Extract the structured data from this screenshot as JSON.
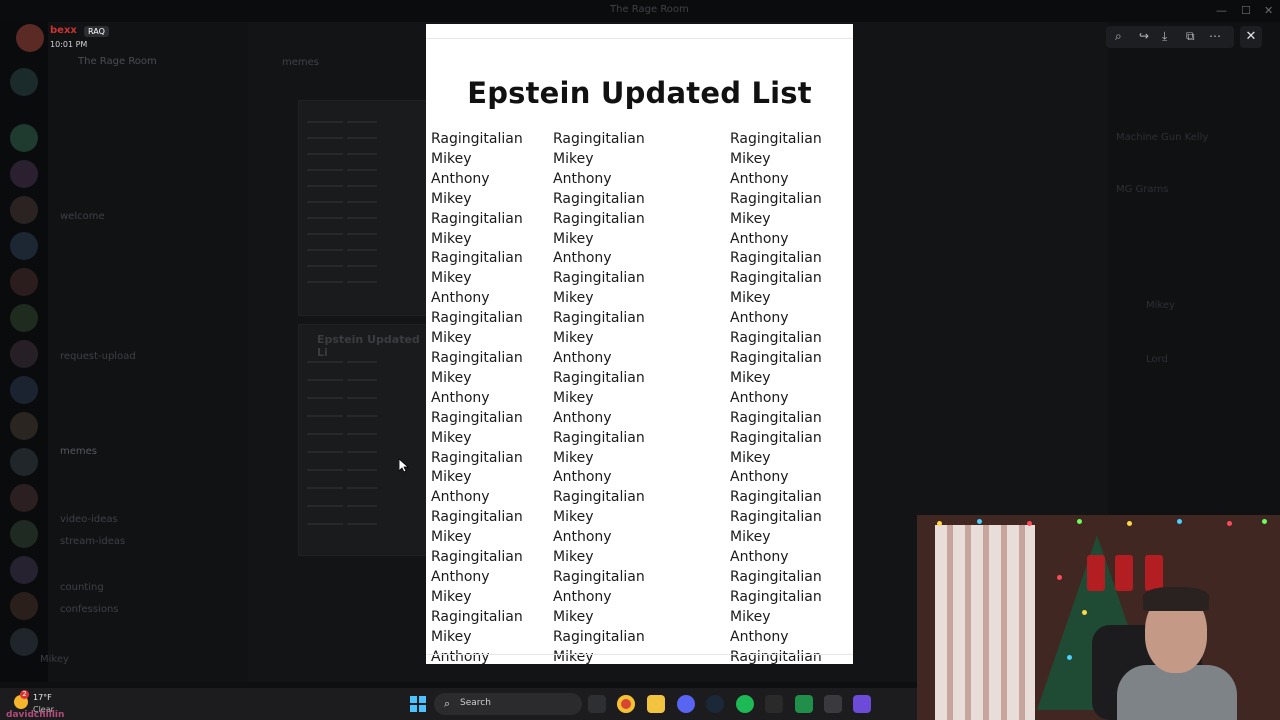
{
  "window": {
    "title": "The Rage Room"
  },
  "user": {
    "name": "bexx",
    "badge": "RAQ",
    "time": "10:01 PM"
  },
  "server": {
    "name": "The Rage Room"
  },
  "channel_header": {
    "name": "memes"
  },
  "channels": [
    {
      "label": "welcome",
      "active": false
    },
    {
      "label": "request-upload",
      "active": false
    },
    {
      "label": "memes",
      "active": true
    },
    {
      "label": "video-ideas",
      "active": false
    },
    {
      "label": "stream-ideas",
      "active": false
    },
    {
      "label": "counting",
      "active": false
    },
    {
      "label": "confessions",
      "active": false
    }
  ],
  "members": [
    "Machine Gun Kelly",
    "MG Grams",
    "Mikey",
    "Lord"
  ],
  "voice_user": "Mikey",
  "background_image": {
    "title": "Epstein Updated Li"
  },
  "viewer": {
    "title": "Epstein Updated List",
    "columns": [
      [
        "Ragingitalian",
        "Mikey",
        "Anthony",
        "Mikey",
        "Ragingitalian",
        "Mikey",
        "Ragingitalian",
        "Mikey",
        "Anthony",
        "Ragingitalian",
        "Mikey",
        "Ragingitalian",
        "Mikey",
        "Anthony",
        "Ragingitalian",
        "Mikey",
        "Ragingitalian",
        "Mikey",
        "Anthony",
        "Ragingitalian",
        "Mikey",
        "Ragingitalian",
        "Anthony",
        "Mikey",
        "Ragingitalian",
        "Mikey",
        "Anthony"
      ],
      [
        "Ragingitalian",
        "Mikey",
        "Anthony",
        "Ragingitalian",
        "Ragingitalian",
        "Mikey",
        "Anthony",
        "Ragingitalian",
        "Mikey",
        "Ragingitalian",
        "Mikey",
        "Anthony",
        "Ragingitalian",
        "Mikey",
        "Anthony",
        "Ragingitalian",
        "Mikey",
        "Anthony",
        "Ragingitalian",
        "Mikey",
        "Anthony",
        "Mikey",
        "Ragingitalian",
        "Anthony",
        "Mikey",
        "Ragingitalian",
        "Mikey"
      ],
      [
        "Ragingitalian",
        "Mikey",
        "Anthony",
        "Ragingitalian",
        "Mikey",
        "Anthony",
        "Ragingitalian",
        "Ragingitalian",
        "Mikey",
        "Anthony",
        "Ragingitalian",
        "Ragingitalian",
        "Mikey",
        "Anthony",
        "Ragingitalian",
        "Ragingitalian",
        "Mikey",
        "Anthony",
        "Ragingitalian",
        "Ragingitalian",
        "Mikey",
        "Anthony",
        "Ragingitalian",
        "Ragingitalian",
        "Mikey",
        "Anthony",
        "Ragingitalian"
      ]
    ],
    "toolbar_icons": [
      "zoom-icon",
      "forward-icon",
      "download-icon",
      "open-external-icon",
      "more-icon"
    ],
    "close_label": "✕"
  },
  "taskbar": {
    "weather_temp": "17°F",
    "weather_cond": "Clear",
    "weather_badge": "2",
    "search_label": "Search",
    "chat_user": "davidchillin",
    "apps": [
      "file-explorer-icon",
      "chrome-icon",
      "folder-icon",
      "discord-icon",
      "steam-icon",
      "spotify-icon",
      "epic-games-icon",
      "app-icon",
      "m-icon",
      "grid-app-icon"
    ]
  },
  "colors": {
    "accent_red": "#c33",
    "win_blue": "#4cc2ff",
    "viewer_bg": "#ffffff"
  }
}
